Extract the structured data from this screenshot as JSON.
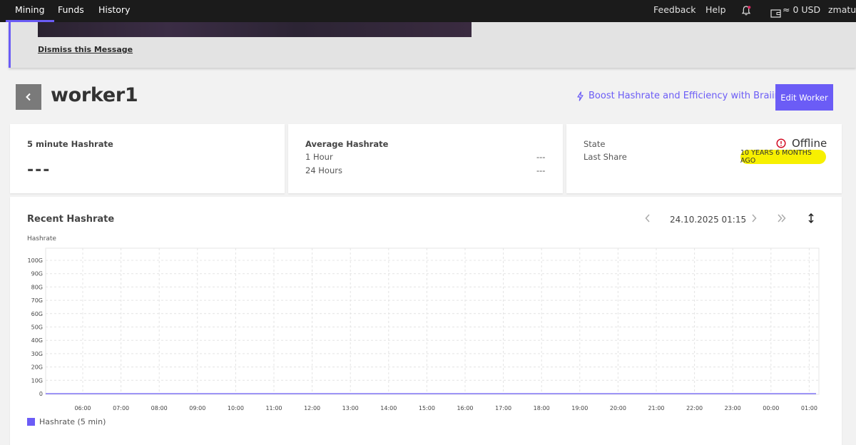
{
  "nav": {
    "items": [
      {
        "label": "Mining",
        "active": true
      },
      {
        "label": "Funds",
        "active": false
      },
      {
        "label": "History",
        "active": false
      }
    ],
    "feedback": "Feedback",
    "help": "Help",
    "wallet": "≈ 0 USD",
    "user": "zmatus"
  },
  "banner": {
    "dismiss": "Dismiss this Message"
  },
  "header": {
    "title": "worker1",
    "boost": "Boost Hashrate and Efficiency with Braiins OS",
    "edit": "Edit Worker"
  },
  "hashrate5": {
    "title": "5 minute Hashrate",
    "value": "---"
  },
  "average": {
    "title": "Average Hashrate",
    "rows": [
      {
        "label": "1 Hour",
        "value": "---"
      },
      {
        "label": "24 Hours",
        "value": "---"
      }
    ]
  },
  "state": {
    "label": "State",
    "value": "Offline",
    "last_share_label": "Last Share",
    "last_share_value": "10 YEARS 6 MONTHS AGO"
  },
  "chart": {
    "title": "Recent Hashrate",
    "date": "24.10.2025 01:15",
    "legend": "Hashrate (5 min)"
  },
  "colors": {
    "accent": "#6b5cf6",
    "highlight": "#f7f000",
    "error": "#d0021b"
  },
  "chart_data": {
    "type": "line",
    "ylabel": "Hashrate",
    "y_ticks": [
      "0",
      "10G",
      "20G",
      "30G",
      "40G",
      "50G",
      "60G",
      "70G",
      "80G",
      "90G",
      "100G"
    ],
    "categories": [
      "06:00",
      "07:00",
      "08:00",
      "09:00",
      "10:00",
      "11:00",
      "12:00",
      "13:00",
      "14:00",
      "15:00",
      "16:00",
      "17:00",
      "18:00",
      "19:00",
      "20:00",
      "21:00",
      "22:00",
      "23:00",
      "00:00",
      "01:00"
    ],
    "ylim": [
      0,
      100
    ],
    "series": [
      {
        "name": "Hashrate (5 min)",
        "values": [
          0,
          0,
          0,
          0,
          0,
          0,
          0,
          0,
          0,
          0,
          0,
          0,
          0,
          0,
          0,
          0,
          0,
          0,
          0,
          0
        ]
      }
    ],
    "grid": true,
    "legend": "bottom-left"
  }
}
